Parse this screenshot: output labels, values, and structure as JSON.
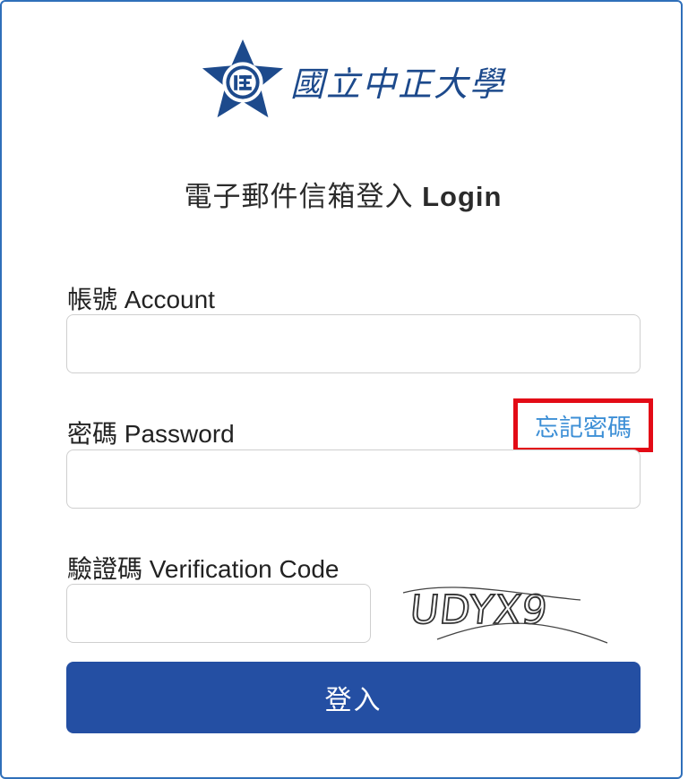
{
  "header": {
    "logo_text": "國立中正大學",
    "title_zh": "電子郵件信箱登入 ",
    "title_en": "Login"
  },
  "form": {
    "account_label": "帳號 Account",
    "account_value": "",
    "password_label": "密碼 Password",
    "password_value": "",
    "forgot_password_link": "忘記密碼",
    "captcha_label": "驗證碼 Verification Code",
    "captcha_value": "",
    "captcha_image_text": "UDYX9",
    "submit_label": "登入"
  },
  "colors": {
    "brand_blue": "#244fa3",
    "link_blue": "#3d8fd6",
    "highlight_red": "#e30b16",
    "border_blue": "#2f6fba"
  },
  "icons": {
    "logo": "university-emblem-icon"
  }
}
